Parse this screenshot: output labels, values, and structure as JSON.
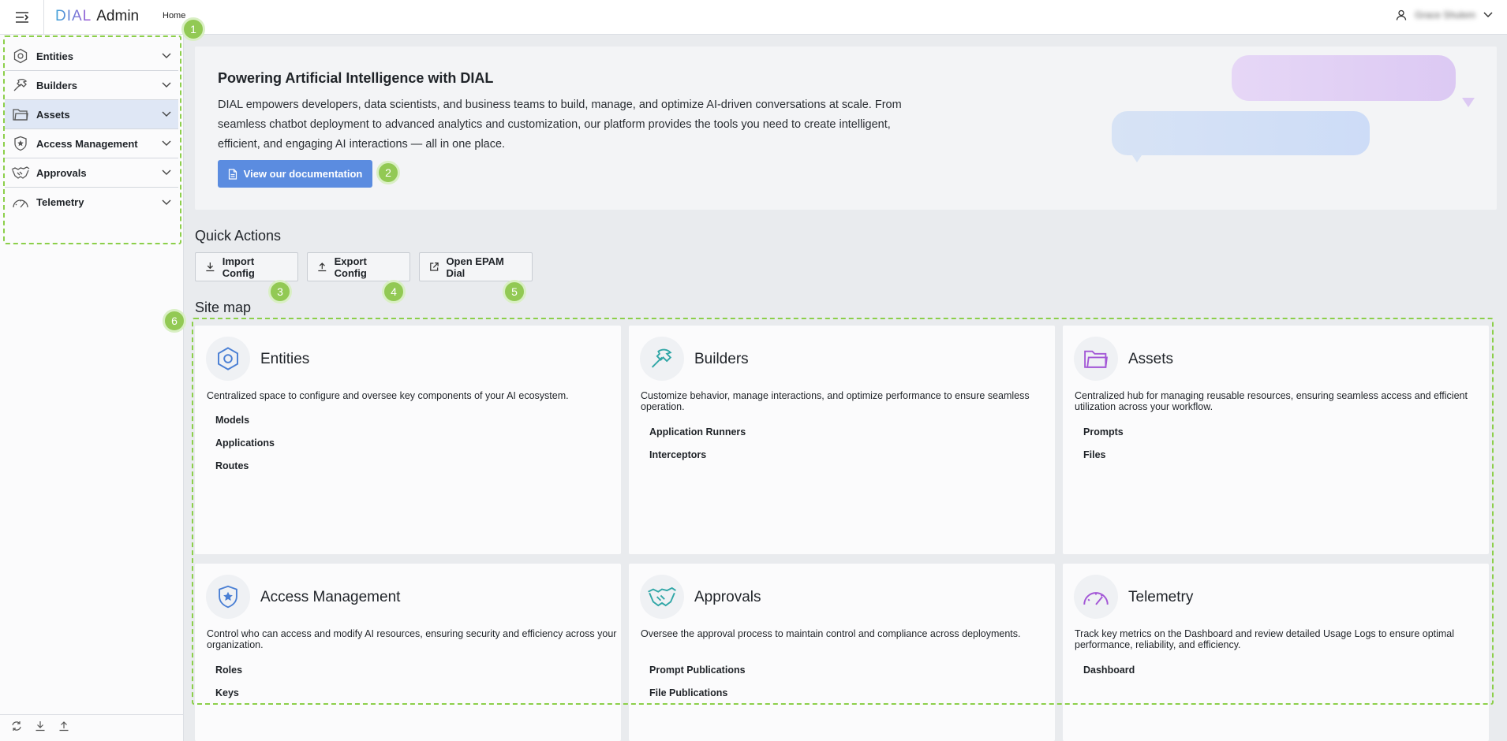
{
  "topbar": {
    "logo_dial": "DIAL",
    "logo_admin": "Admin",
    "breadcrumb": "Home",
    "user_name": "Grace Shulem"
  },
  "sidebar": {
    "items": [
      {
        "label": "Entities",
        "icon": "hexagon-icon"
      },
      {
        "label": "Builders",
        "icon": "hammer-icon"
      },
      {
        "label": "Assets",
        "icon": "folder-icon"
      },
      {
        "label": "Access Management",
        "icon": "shield-star-icon"
      },
      {
        "label": "Approvals",
        "icon": "handshake-icon"
      },
      {
        "label": "Telemetry",
        "icon": "gauge-icon"
      }
    ],
    "active": "Assets"
  },
  "annotations": [
    "1",
    "2",
    "3",
    "4",
    "5",
    "6"
  ],
  "hero": {
    "title": "Powering Artificial Intelligence with DIAL",
    "body": "DIAL empowers developers, data scientists, and business teams to build, manage, and optimize AI-driven conversations at scale. From seamless chatbot deployment to advanced analytics and customization, our platform provides the tools you need to create intelligent, efficient, and engaging AI interactions — all in one place.",
    "button": "View our documentation"
  },
  "quick_actions": {
    "title": "Quick Actions",
    "buttons": [
      "Import Config",
      "Export Config",
      "Open EPAM Dial"
    ]
  },
  "site_map": {
    "title": "Site map",
    "cards": [
      {
        "title": "Entities",
        "description": "Centralized space to configure and oversee key components of your AI ecosystem.",
        "links": [
          "Models",
          "Applications",
          "Routes"
        ]
      },
      {
        "title": "Builders",
        "description": "Customize behavior, manage interactions, and optimize performance to ensure seamless operation.",
        "links": [
          "Application Runners",
          "Interceptors"
        ]
      },
      {
        "title": "Assets",
        "description": "Centralized hub for managing reusable resources, ensuring seamless access and efficient utilization across your workflow.",
        "links": [
          "Prompts",
          "Files"
        ]
      },
      {
        "title": "Access Management",
        "description": "Control who can access and modify AI resources, ensuring security and efficiency across your organization.",
        "links": [
          "Roles",
          "Keys"
        ]
      },
      {
        "title": "Approvals",
        "description": "Oversee the approval process to maintain control and compliance across deployments.",
        "links": [
          "Prompt Publications",
          "File Publications"
        ]
      },
      {
        "title": "Telemetry",
        "description": "Track key metrics on the Dashboard and review detailed Usage Logs to ensure optimal performance, reliability, and efficiency.",
        "links": [
          "Dashboard"
        ]
      }
    ]
  },
  "colors": {
    "primary_button": "#5b8ce0",
    "annotation_green": "#92c954",
    "icon_blue": "#4a7fd4",
    "icon_teal": "#2fa6a6",
    "icon_purple": "#a357d6"
  }
}
